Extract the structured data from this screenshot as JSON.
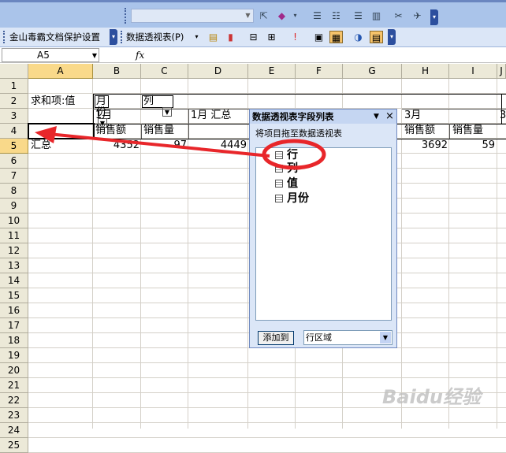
{
  "toolbar_top": {
    "combo_value": "",
    "icons": [
      "workflow-icon",
      "style-icon",
      "align-left-icon",
      "align-center-icon",
      "align-right-icon",
      "justify-icon",
      "link-icon",
      "chain-icon"
    ]
  },
  "toolbar_second": {
    "wps_label": "金山毒霸文档保护设置",
    "pivot_label": "数据透视表(P)",
    "icons": [
      "format-report-icon",
      "chart-wizard-icon",
      "refresh-icon",
      "hide-detail-icon",
      "show-detail-icon",
      "field-settings-icon",
      "table-options-icon",
      "field-list-icon"
    ]
  },
  "formula_bar": {
    "name_box": "A5",
    "fx_label": "fx",
    "formula": ""
  },
  "columns": [
    "A",
    "B",
    "C",
    "D",
    "E",
    "F",
    "G",
    "H",
    "I",
    "J"
  ],
  "rows": [
    "1",
    "2",
    "3",
    "4",
    "5",
    "6",
    "7",
    "8",
    "9",
    "10",
    "11",
    "12",
    "13",
    "14",
    "15",
    "16",
    "17",
    "18",
    "19",
    "20",
    "21",
    "22",
    "23",
    "24",
    "25"
  ],
  "cells": {
    "a3": "求和项:值",
    "b3": "月份",
    "c3": "列",
    "b4": "1月",
    "d4": "1月 汇总",
    "h4": "3月",
    "j4": "3",
    "b5": "销售额",
    "c5": "销售量",
    "h5": "销售额",
    "i5": "销售量",
    "a6": "汇总",
    "b6": "4352",
    "c6": "97",
    "d6": "4449",
    "g6": "",
    "h6": "3692",
    "i6": "59"
  },
  "pivot_panel": {
    "title": "数据透视表字段列表",
    "subtitle": "将项目拖至数据透视表",
    "fields": [
      "行",
      "列",
      "值",
      "月份"
    ],
    "add_button": "添加到",
    "area_value": "行区域"
  },
  "annotation_color": "#e8262a",
  "watermark": "Baidu经验"
}
